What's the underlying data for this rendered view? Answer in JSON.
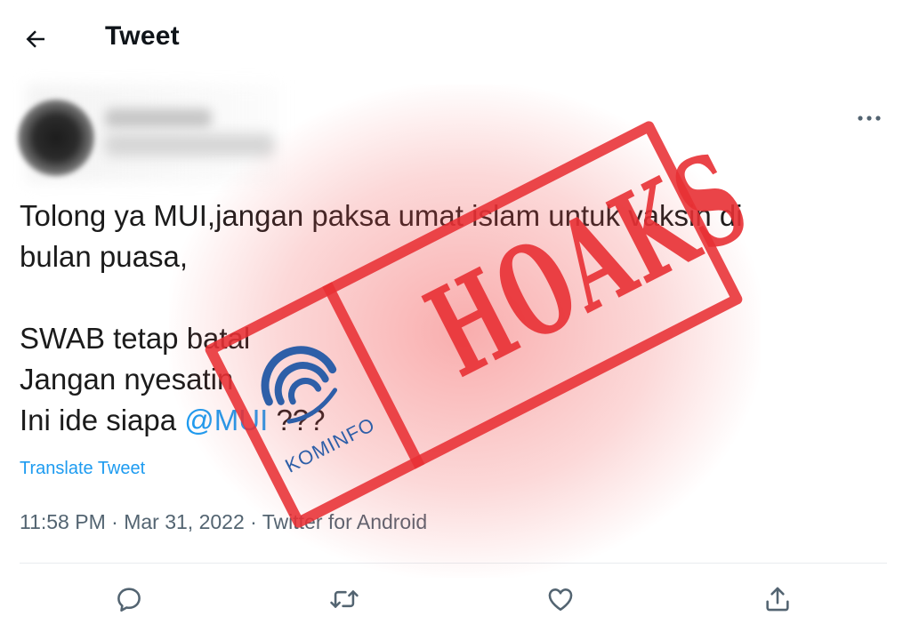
{
  "header": {
    "back_icon": "arrow-left-icon",
    "title": "Tweet"
  },
  "author": {
    "avatar": "blurred",
    "name": "",
    "handle": ""
  },
  "more_icon": "more-horizontal-icon",
  "tweet": {
    "lines": [
      "Tolong ya MUI,jangan paksa umat islam untuk vaksin di",
      "bulan puasa,",
      "SWAB tetap batal",
      "Jangan nyesatin",
      "Ini ide siapa "
    ],
    "mention": "@MUI",
    "mention_suffix": " ???",
    "translate_label": "Translate Tweet",
    "time": "11:58 PM",
    "date": "Mar 31, 2022",
    "source": "Twitter for Android",
    "separator": " · "
  },
  "actions": [
    {
      "name": "reply",
      "icon": "reply-icon"
    },
    {
      "name": "retweet",
      "icon": "retweet-icon"
    },
    {
      "name": "like",
      "icon": "heart-icon"
    },
    {
      "name": "share",
      "icon": "share-icon"
    }
  ],
  "stamp": {
    "word": "HOAKS",
    "logo_label": "KOMINFO",
    "color": "#e83034",
    "logo_color": "#2e5fa8"
  },
  "colors": {
    "accent": "#1d9bf0",
    "meta_text": "#536471",
    "text": "#0f1419"
  }
}
